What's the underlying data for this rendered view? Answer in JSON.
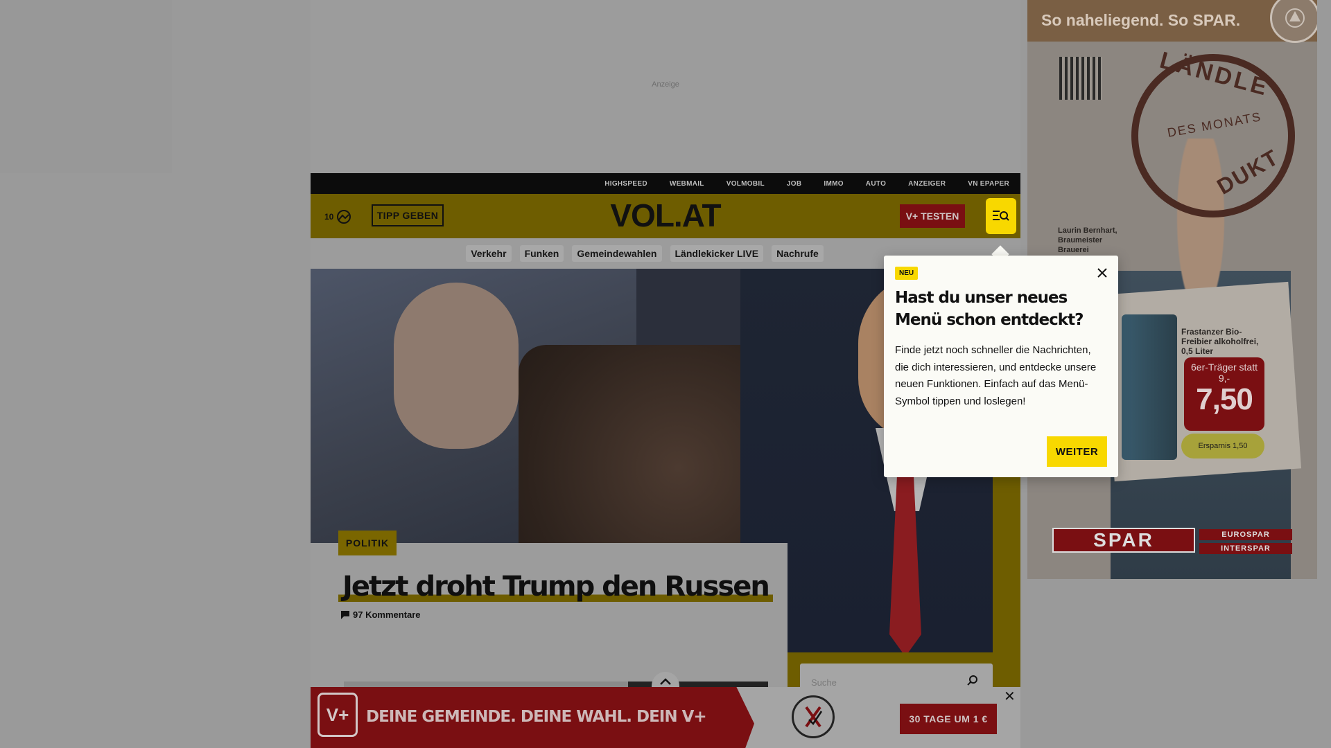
{
  "ad": {
    "label": "Anzeige"
  },
  "topbar": {
    "links": [
      "HIGHSPEED",
      "WEBMAIL",
      "VOLMOBIL",
      "JOB",
      "IMMO",
      "AUTO",
      "ANZEIGER",
      "VN EPAPER"
    ]
  },
  "header": {
    "weather_temp": "10",
    "tipp_label": "TIPP GEBEN",
    "logo": "VOL.AT",
    "vplus_label": "V+ TESTEN"
  },
  "subnav": {
    "items": [
      "Verkehr",
      "Funken",
      "Gemeindewahlen",
      "Ländlekicker LIVE",
      "Nachrufe"
    ]
  },
  "article": {
    "category": "POLITIK",
    "headline": "Jetzt droht Trump den Russen",
    "comments": "97 Kommentare"
  },
  "search": {
    "placeholder": "Suche"
  },
  "popup": {
    "badge": "NEU",
    "title": "Hast du unser neues Menü schon entdeckt?",
    "body": "Finde jetzt noch schneller die Nachrichten, die dich interessieren, und entdecke unsere neuen Funktionen. Einfach auf das Menü-Symbol tippen und loslegen!",
    "button": "WEITER"
  },
  "banner": {
    "badge": "V+",
    "text": "DEINE GEMEINDE. DEINE WAHL. DEIN V+",
    "cta": "30 TAGE UM 1 €"
  },
  "right_ad": {
    "tagline": "So naheliegend. So SPAR.",
    "stamp_top": "LÄNDLE",
    "stamp_mid": "DES MONATS",
    "stamp_bot": "DUKT",
    "person": "Laurin Bernhart, Braumeister Brauerei",
    "product": "Frastanzer Bio-Freibier alkoholfrei, 0,5 Liter",
    "price_label": "6er-Träger statt 9,-",
    "price": "7,50",
    "saving": "Ersparnis 1,50",
    "brand": "SPAR",
    "brand2": "EUROSPAR",
    "brand3": "INTERSPAR"
  },
  "colors": {
    "brand_yellow": "#f8d800",
    "vplus_red": "#7a0f12"
  }
}
